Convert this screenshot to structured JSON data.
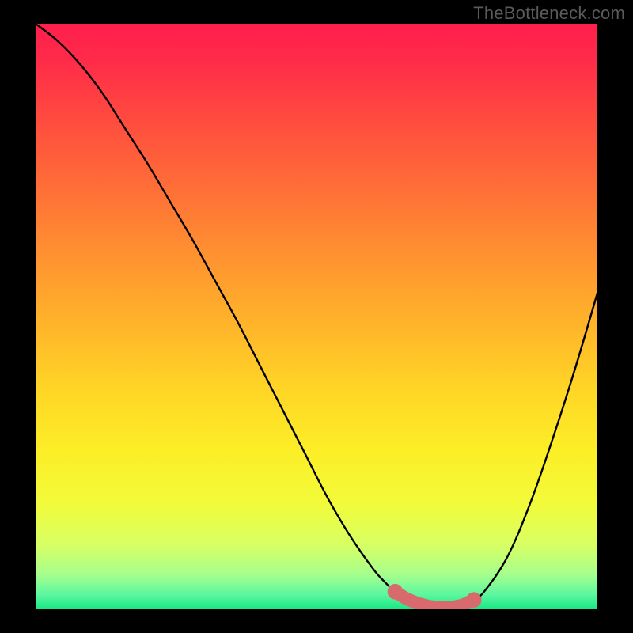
{
  "watermark": "TheBottleneck.com",
  "colors": {
    "curve": "#000000",
    "highlight": "#d86a6e",
    "gradient_top": "#ff1f4c",
    "gradient_bottom": "#17e884",
    "frame": "#000000"
  },
  "chart_data": {
    "type": "line",
    "title": "",
    "xlabel": "",
    "ylabel": "",
    "xlim": [
      0,
      100
    ],
    "ylim": [
      0,
      100
    ],
    "x": [
      0,
      4,
      8,
      12,
      16,
      20,
      24,
      28,
      32,
      36,
      40,
      44,
      48,
      52,
      56,
      60,
      62,
      64,
      66,
      68,
      70,
      72,
      74,
      76,
      78,
      80,
      84,
      88,
      92,
      96,
      100
    ],
    "values": [
      100,
      97,
      93,
      88,
      82,
      76,
      69.5,
      63,
      56,
      49,
      41.5,
      34,
      26.5,
      19,
      12.5,
      7,
      4.8,
      3,
      1.8,
      1,
      0.5,
      0.3,
      0.3,
      0.7,
      1.6,
      3.2,
      9,
      18,
      29,
      41,
      54
    ],
    "flat_region": {
      "x_start": 64,
      "x_end": 78,
      "y": 1.5,
      "stroke_width_value": 2.2
    }
  }
}
